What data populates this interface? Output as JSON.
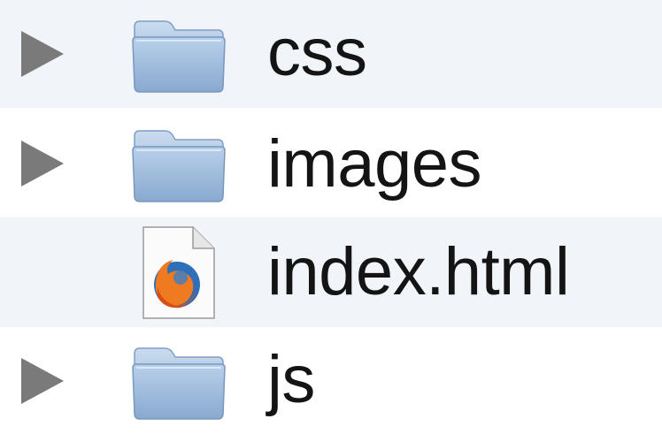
{
  "finder_list": {
    "items": [
      {
        "label": "css",
        "kind": "folder",
        "icon": "folder-icon",
        "expandable": true
      },
      {
        "label": "images",
        "kind": "folder",
        "icon": "folder-icon",
        "expandable": true
      },
      {
        "label": "index.html",
        "kind": "file",
        "icon": "firefox-html-document-icon",
        "expandable": false
      },
      {
        "label": "js",
        "kind": "folder",
        "icon": "folder-icon",
        "expandable": true
      }
    ]
  },
  "colors": {
    "row_stripe": "#f1f5fa",
    "row_plain": "#ffffff",
    "disclosure_triangle": "#7a7a7a",
    "folder_blue": "#a8c3e0",
    "label_text": "#141414"
  }
}
